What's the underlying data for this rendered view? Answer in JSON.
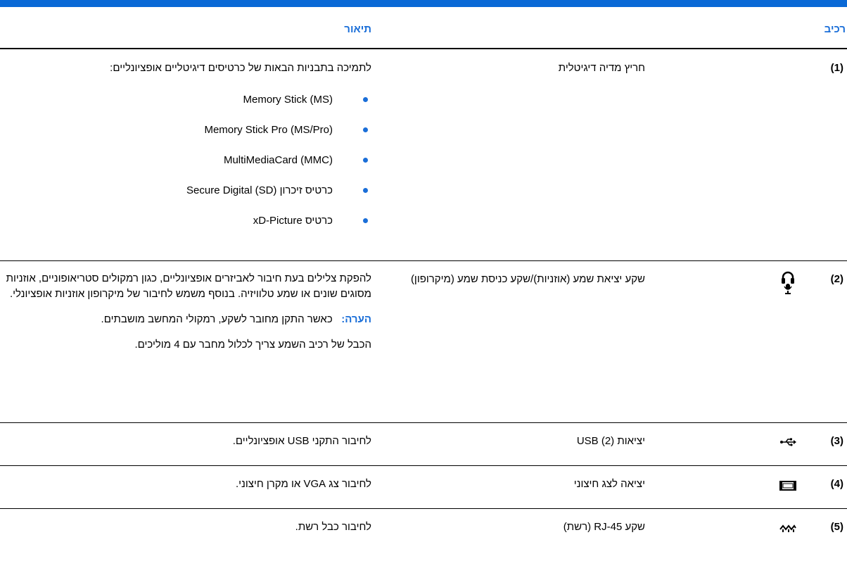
{
  "header": {
    "component": "רכיב",
    "description": "תיאור"
  },
  "colors": {
    "accent": "#1a6ed8",
    "top_bar": "#0a69d6"
  },
  "rows": [
    {
      "num": "(1)",
      "name": "חריץ מדיה דיגיטלית",
      "icon": "",
      "intro": "לתמיכה בתבניות הבאות של כרטיסים דיגיטליים אופציונליים:",
      "bullets": [
        "Memory Stick (MS)",
        "Memory Stick Pro (MS/Pro)",
        "MultiMediaCard (MMC)",
        "כרטיס זיכרון Secure Digital (SD)",
        "כרטיס xD-Picture"
      ]
    },
    {
      "num": "(2)",
      "name": "שקע יציאת שמע (אוזניות)/שקע כניסת שמע (מיקרופון)",
      "icon": "headset-microphone-icon",
      "paragraph": "להפקת צלילים בעת חיבור לאביזרים אופציונליים, כגון רמקולים סטריאופוניים, אוזניות מסוגים שונים או שמע טלוויזיה. בנוסף משמש לחיבור של מיקרופון אוזניות אופציונלי.",
      "note_label": "הערה:",
      "note_text": "כאשר התקן מחובר לשקע, רמקולי המחשב מושבתים.",
      "footer": "הכבל של רכיב השמע צריך לכלול מחבר עם 4 מוליכים."
    },
    {
      "num": "(3)",
      "name": "יציאות USB (2)",
      "icon": "usb-icon",
      "desc": "לחיבור התקני USB אופציונליים."
    },
    {
      "num": "(4)",
      "name": "יציאה לצג חיצוני",
      "icon": "monitor-port-icon",
      "desc": "לחיבור צג VGA או מקרן חיצוני."
    },
    {
      "num": "(5)",
      "name": "שקע RJ-45 (רשת)",
      "icon": "network-jack-icon",
      "desc": "לחיבור כבל רשת."
    }
  ]
}
